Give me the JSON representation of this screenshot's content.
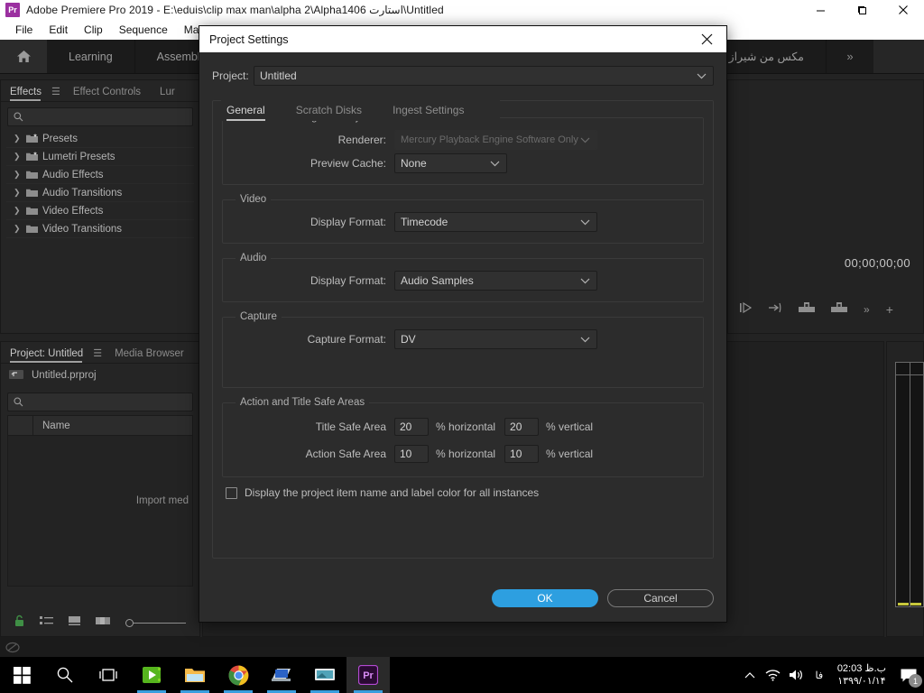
{
  "window": {
    "app_icon": "premiere-pro-icon",
    "title": "Adobe Premiere Pro 2019 - E:\\eduis\\clip max man\\alpha 2\\Alpha1406 استارت\\Untitled",
    "minimize": "minimize-icon",
    "maximize": "maximize-icon",
    "close": "close-icon"
  },
  "menubar": {
    "items": [
      "File",
      "Edit",
      "Clip",
      "Sequence",
      "Markers"
    ]
  },
  "workspace": {
    "home_icon": "home-icon",
    "tabs": [
      "Learning",
      "Assembly"
    ],
    "rtl_tab": "مکس من شیراز .com",
    "overflow": "»"
  },
  "effects_panel": {
    "tabs": [
      {
        "label": "Effects",
        "active": true
      },
      {
        "label": "Effect Controls",
        "active": false
      },
      {
        "label": "Lur",
        "active": false
      }
    ],
    "menu_icon": "hamburger-icon",
    "search_placeholder": "",
    "search_value": "",
    "search_icon": "search-icon",
    "tree": [
      {
        "label": "Presets",
        "icon": "folder-star-icon"
      },
      {
        "label": "Lumetri Presets",
        "icon": "folder-star-icon"
      },
      {
        "label": "Audio Effects",
        "icon": "folder-icon"
      },
      {
        "label": "Audio Transitions",
        "icon": "folder-icon"
      },
      {
        "label": "Video Effects",
        "icon": "folder-icon"
      },
      {
        "label": "Video Transitions",
        "icon": "folder-icon"
      }
    ]
  },
  "project_panel": {
    "tabs": [
      {
        "label": "Project: Untitled",
        "active": true
      },
      {
        "label": "Media Browser",
        "active": false
      }
    ],
    "menu_icon": "hamburger-icon",
    "file_name": "Untitled.prproj",
    "file_icon": "project-file-icon",
    "search_value": "",
    "search_icon": "search-icon",
    "column_header": "Name",
    "empty_hint": "Import med",
    "tools": [
      "lock-icon",
      "list-view-icon",
      "icon-view-icon",
      "freeform-view-icon",
      "zoom-slider"
    ]
  },
  "monitor": {
    "timecode": "00;00;00;00",
    "tools": [
      "play-in-to-out-icon",
      "go-to-next-edit-icon",
      "lift-icon",
      "extract-icon",
      "more-icon",
      "add-icon"
    ]
  },
  "dialog": {
    "title": "Project Settings",
    "close_icon": "close-icon",
    "project_label": "Project:",
    "project_value": "Untitled",
    "tabs": [
      {
        "label": "General",
        "active": true
      },
      {
        "label": "Scratch Disks",
        "active": false
      },
      {
        "label": "Ingest Settings",
        "active": false
      }
    ],
    "groups": {
      "video_rendering": {
        "legend": "Video Rendering and Playback",
        "renderer_label": "Renderer:",
        "renderer_value": "Mercury Playback Engine Software Only",
        "renderer_disabled": true,
        "preview_cache_label": "Preview Cache:",
        "preview_cache_value": "None"
      },
      "video": {
        "legend": "Video",
        "display_format_label": "Display Format:",
        "display_format_value": "Timecode"
      },
      "audio": {
        "legend": "Audio",
        "display_format_label": "Display Format:",
        "display_format_value": "Audio Samples"
      },
      "capture": {
        "legend": "Capture",
        "capture_format_label": "Capture Format:",
        "capture_format_value": "DV"
      },
      "safe_areas": {
        "legend": "Action and Title Safe Areas",
        "title_safe_label": "Title Safe Area",
        "title_safe_h": "20",
        "title_safe_v": "20",
        "action_safe_label": "Action Safe Area",
        "action_safe_h": "10",
        "action_safe_v": "10",
        "unit_horizontal": "% horizontal",
        "unit_vertical": "% vertical"
      }
    },
    "checkbox_label": "Display the project item name and label color for all instances",
    "checkbox_checked": false,
    "ok_label": "OK",
    "cancel_label": "Cancel",
    "accent_color": "#2d9fe0"
  },
  "taskbar": {
    "items": [
      {
        "name": "start-button",
        "icon": "windows-logo-icon"
      },
      {
        "name": "search-button",
        "icon": "search-icon"
      },
      {
        "name": "task-view-button",
        "icon": "task-view-icon"
      },
      {
        "name": "taskbar-app-editor",
        "icon": "green-film-icon"
      },
      {
        "name": "taskbar-app-explorer",
        "icon": "folder-icon"
      },
      {
        "name": "taskbar-app-chrome",
        "icon": "chrome-icon"
      },
      {
        "name": "taskbar-app-media1",
        "icon": "blue-monitor-icon"
      },
      {
        "name": "taskbar-app-media2",
        "icon": "grey-monitor-icon"
      },
      {
        "name": "taskbar-app-premiere",
        "icon": "premiere-pro-icon"
      }
    ],
    "tray": {
      "chevron": "show-hidden-icon",
      "network": "wifi-icon",
      "volume": "volume-icon",
      "language": "فا",
      "time": "02:03 ب.ظ",
      "date": "۱۳۹۹/۰۱/۱۴",
      "notifications": "notification-icon",
      "notification_count": "1"
    }
  }
}
